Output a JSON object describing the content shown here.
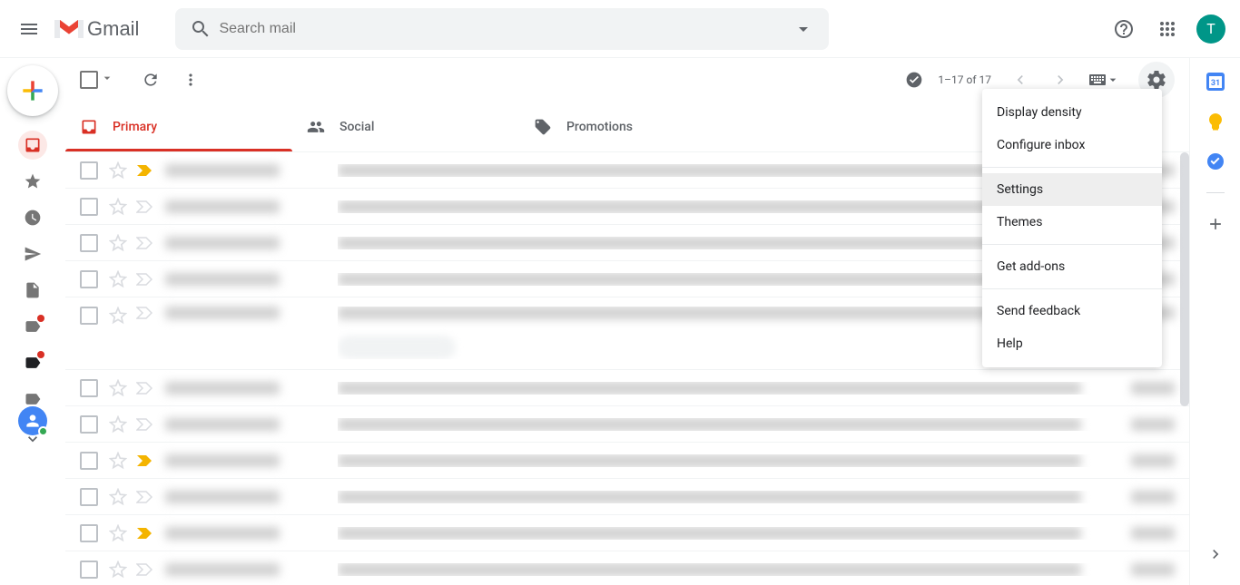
{
  "header": {
    "app_name": "Gmail",
    "search_placeholder": "Search mail",
    "avatar_initial": "T"
  },
  "toolbar": {
    "page_info": "1–17 of 17"
  },
  "tabs": [
    {
      "label": "Primary",
      "active": true
    },
    {
      "label": "Social",
      "active": false
    },
    {
      "label": "Promotions",
      "active": false
    }
  ],
  "settings_menu": [
    {
      "label": "Display density",
      "highlighted": false
    },
    {
      "label": "Configure inbox",
      "highlighted": false,
      "divider_after": true
    },
    {
      "label": "Settings",
      "highlighted": true
    },
    {
      "label": "Themes",
      "highlighted": false,
      "divider_after": true
    },
    {
      "label": "Get add-ons",
      "highlighted": false,
      "divider_after": true
    },
    {
      "label": "Send feedback",
      "highlighted": false
    },
    {
      "label": "Help",
      "highlighted": false
    }
  ],
  "emails": [
    {
      "marker": "yellow",
      "attachment": false
    },
    {
      "marker": "none",
      "attachment": false
    },
    {
      "marker": "none",
      "attachment": false
    },
    {
      "marker": "none",
      "attachment": false
    },
    {
      "marker": "none",
      "attachment": true
    },
    {
      "marker": "none",
      "attachment": false
    },
    {
      "marker": "none",
      "attachment": false
    },
    {
      "marker": "yellow",
      "attachment": false
    },
    {
      "marker": "none",
      "attachment": false
    },
    {
      "marker": "yellow",
      "attachment": false
    },
    {
      "marker": "none",
      "attachment": false
    }
  ]
}
